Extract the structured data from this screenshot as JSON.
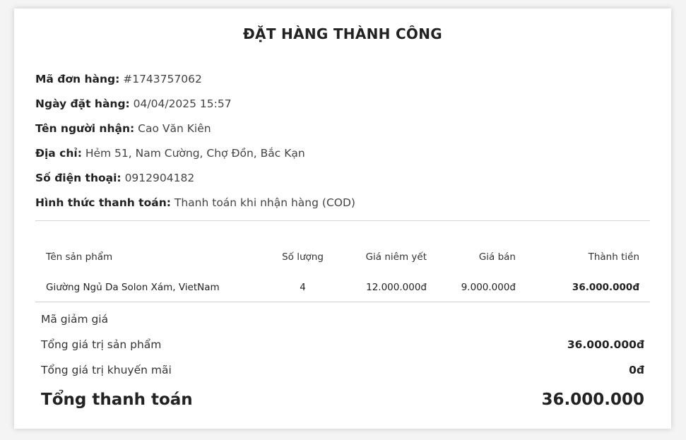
{
  "title": "ĐẶT HÀNG THÀNH CÔNG",
  "order_info": {
    "order_id_label": "Mã đơn hàng:",
    "order_id_value": "#1743757062",
    "order_date_label": "Ngày đặt hàng:",
    "order_date_value": "04/04/2025 15:57",
    "recipient_label": "Tên người nhận:",
    "recipient_value": "Cao Văn Kiên",
    "address_label": "Địa chỉ:",
    "address_value": "Hẻm 51, Nam Cường, Chợ Đồn, Bắc Kạn",
    "phone_label": "Số điện thoại:",
    "phone_value": "0912904182",
    "payment_label": "Hình thức thanh toán:",
    "payment_value": "Thanh toán khi nhận hàng (COD)"
  },
  "table": {
    "headers": [
      "Tên sản phẩm",
      "Số lượng",
      "Giá niêm yết",
      "Giá bán",
      "Thành tiền"
    ],
    "rows": [
      [
        "Giường Ngủ Da Solon Xám, VietNam",
        "4",
        "12.000.000đ",
        "9.000.000đ",
        "36.000.000đ"
      ]
    ]
  },
  "summary": {
    "discount_code_label": "Mã giảm giá",
    "subtotal_label": "Tổng giá trị sản phẩm",
    "subtotal_value": "36.000.000đ",
    "promo_label": "Tổng giá trị khuyến mãi",
    "promo_value": "0đ",
    "total_label": "Tổng thanh toán",
    "total_value": "36.000.000"
  }
}
